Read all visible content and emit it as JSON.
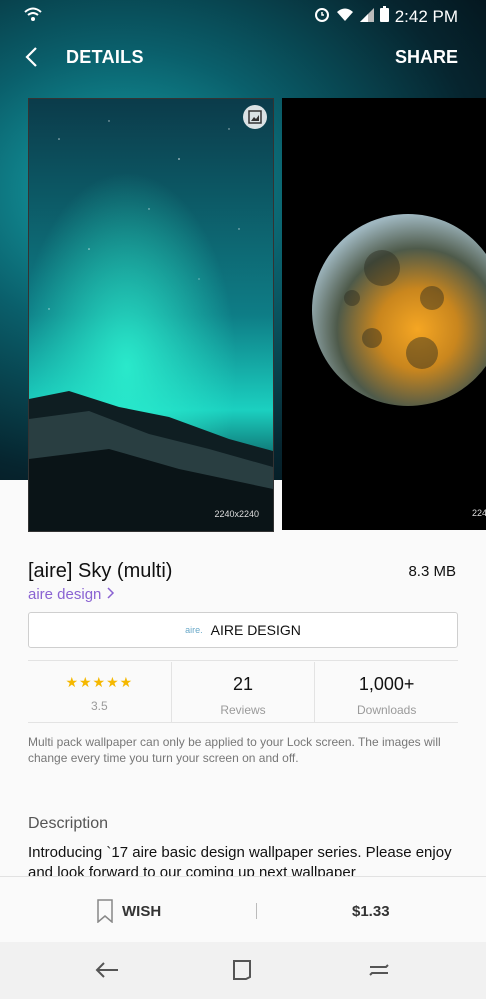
{
  "status": {
    "time": "2:42 PM"
  },
  "appbar": {
    "title": "DETAILS",
    "share_label": "SHARE"
  },
  "gallery": {
    "images": [
      {
        "resolution": "2240x2240"
      },
      {
        "resolution": "224"
      }
    ]
  },
  "product": {
    "name": "[aire] Sky (multi)",
    "size": "8.3 MB",
    "developer_link": "aire design",
    "developer_button": "AIRE DESIGN",
    "developer_logo": "aire."
  },
  "stats": {
    "rating_value": "3.5",
    "stars_glyphs": "★★★★★",
    "reviews_count": "21",
    "reviews_label": "Reviews",
    "downloads_count": "1,000+",
    "downloads_label": "Downloads"
  },
  "note": "Multi pack wallpaper can only be applied to your Lock screen. The images will change every time you turn your screen on and off.",
  "description": {
    "heading": "Description",
    "text": "Introducing `17 aire basic design wallpaper series. Please enjoy and look forward to our coming up next wallpaper"
  },
  "actions": {
    "wish_label": "WISH",
    "price": "$1.33"
  },
  "colors": {
    "accent": "#8a63d2",
    "star": "#f5b800"
  }
}
